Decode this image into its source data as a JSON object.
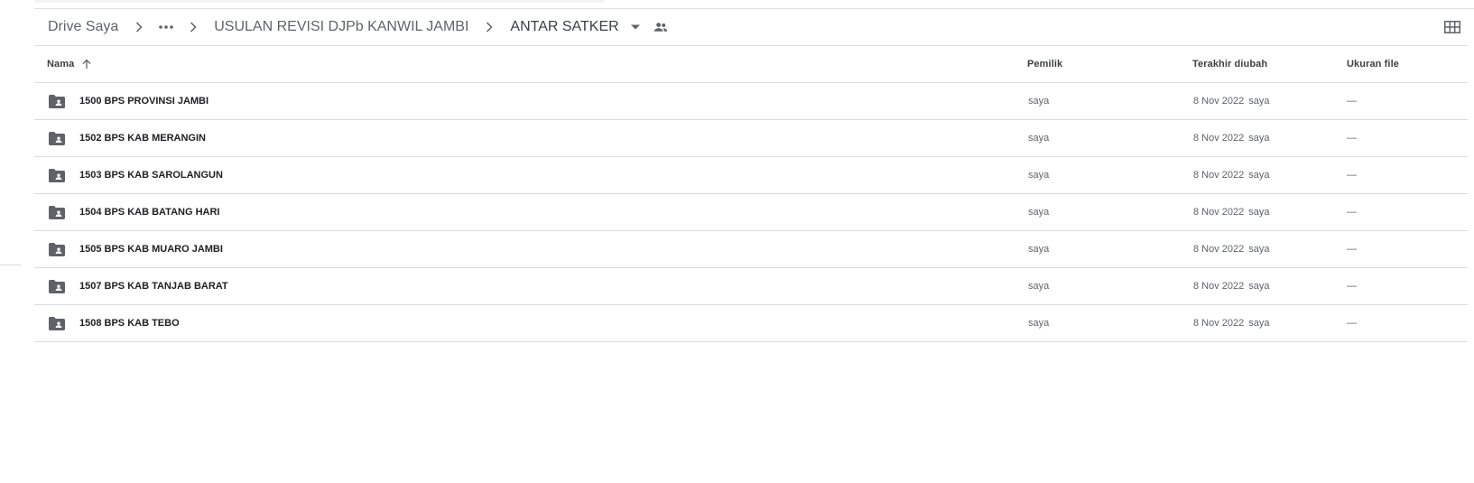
{
  "breadcrumb": {
    "root": "Drive Saya",
    "more": "•••",
    "parent": "USULAN REVISI DJPb KANWIL JAMBI",
    "current": "ANTAR SATKER"
  },
  "icons": {
    "separator": "chevron-right-icon",
    "dropdown": "arrow-drop-down-icon",
    "shared": "people-icon",
    "view": "grid-view-icon",
    "folder": "shared-folder-icon",
    "sort": "arrow-up-icon"
  },
  "columns": {
    "name": "Nama",
    "owner": "Pemilik",
    "modified": "Terakhir diubah",
    "size": "Ukuran file"
  },
  "rows": [
    {
      "name": "1500 BPS PROVINSI JAMBI",
      "owner": "saya",
      "date": "8 Nov 2022",
      "by": "saya",
      "size": "—"
    },
    {
      "name": "1502 BPS KAB MERANGIN",
      "owner": "saya",
      "date": "8 Nov 2022",
      "by": "saya",
      "size": "—"
    },
    {
      "name": "1503 BPS KAB SAROLANGUN",
      "owner": "saya",
      "date": "8 Nov 2022",
      "by": "saya",
      "size": "—"
    },
    {
      "name": "1504 BPS KAB BATANG HARI",
      "owner": "saya",
      "date": "8 Nov 2022",
      "by": "saya",
      "size": "—"
    },
    {
      "name": "1505 BPS KAB MUARO JAMBI",
      "owner": "saya",
      "date": "8 Nov 2022",
      "by": "saya",
      "size": "—"
    },
    {
      "name": "1507 BPS KAB TANJAB BARAT",
      "owner": "saya",
      "date": "8 Nov 2022",
      "by": "saya",
      "size": "—"
    },
    {
      "name": "1508 BPS KAB TEBO",
      "owner": "saya",
      "date": "8 Nov 2022",
      "by": "saya",
      "size": "—"
    }
  ],
  "colors": {
    "text": "#202124",
    "secondary": "#5f6368",
    "divider": "#dadce0",
    "icon": "#5f6368"
  }
}
